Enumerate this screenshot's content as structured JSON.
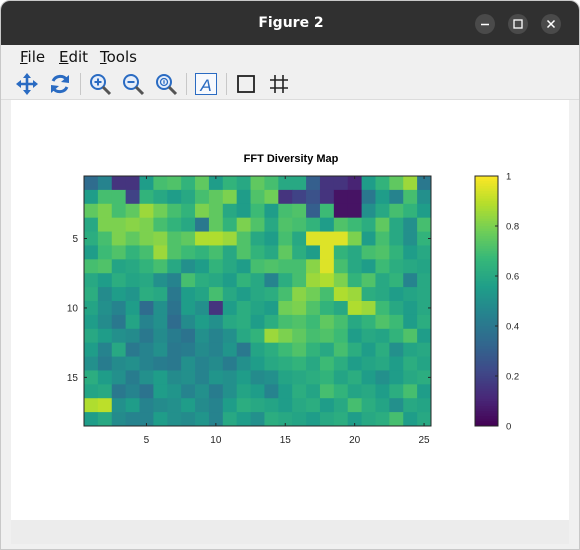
{
  "window": {
    "title": "Figure 2",
    "min_icon": "minimize-icon",
    "max_icon": "maximize-icon",
    "close_icon": "close-icon"
  },
  "menu": {
    "items": [
      {
        "label": "File",
        "key": "F",
        "rest": "ile"
      },
      {
        "label": "Edit",
        "key": "E",
        "rest": "dit"
      },
      {
        "label": "Tools",
        "key": "T",
        "rest": "ools"
      }
    ]
  },
  "toolbar": {
    "tools": [
      "pan-icon",
      "rotate-icon",
      "zoom-in-icon",
      "zoom-out-icon",
      "zoom-reset-icon",
      "text-insert-icon",
      "axes-box-icon",
      "grid-icon"
    ]
  },
  "colors": {
    "title_bar": "#303030",
    "accent": "#2266cc",
    "colormap": "viridis"
  },
  "chart_data": {
    "type": "heatmap",
    "title": "FFT Diversity Map",
    "x_ticks": [
      5,
      10,
      15,
      20,
      25
    ],
    "y_ticks": [
      5,
      10,
      15
    ],
    "xlim": [
      0.5,
      25.5
    ],
    "ylim": [
      0.5,
      18.5
    ],
    "colorbar_ticks": [
      "0",
      "0.2",
      "0.4",
      "0.6",
      "0.8",
      "1"
    ],
    "colorbar_range": [
      0,
      1
    ],
    "colormap": "viridis",
    "rows": 18,
    "cols": 25,
    "values": [
      [
        0.35,
        0.45,
        0.15,
        0.15,
        0.55,
        0.7,
        0.72,
        0.65,
        0.75,
        0.55,
        0.65,
        0.6,
        0.75,
        0.7,
        0.6,
        0.6,
        0.3,
        0.15,
        0.15,
        0.1,
        0.55,
        0.65,
        0.75,
        0.85,
        0.4
      ],
      [
        0.55,
        0.7,
        0.7,
        0.2,
        0.65,
        0.6,
        0.55,
        0.6,
        0.7,
        0.75,
        0.8,
        0.55,
        0.72,
        0.78,
        0.15,
        0.2,
        0.25,
        0.15,
        0.05,
        0.05,
        0.4,
        0.55,
        0.45,
        0.7,
        0.5
      ],
      [
        0.75,
        0.8,
        0.7,
        0.75,
        0.85,
        0.78,
        0.7,
        0.65,
        0.8,
        0.75,
        0.6,
        0.55,
        0.68,
        0.55,
        0.7,
        0.72,
        0.3,
        0.68,
        0.05,
        0.05,
        0.5,
        0.6,
        0.7,
        0.65,
        0.55
      ],
      [
        0.6,
        0.8,
        0.8,
        0.82,
        0.8,
        0.7,
        0.65,
        0.6,
        0.4,
        0.75,
        0.65,
        0.8,
        0.72,
        0.6,
        0.72,
        0.7,
        0.65,
        0.55,
        0.72,
        0.68,
        0.62,
        0.75,
        0.6,
        0.5,
        0.7
      ],
      [
        0.62,
        0.7,
        0.8,
        0.75,
        0.8,
        0.82,
        0.72,
        0.75,
        0.88,
        0.88,
        0.85,
        0.72,
        0.6,
        0.55,
        0.7,
        0.6,
        0.95,
        0.95,
        0.95,
        0.8,
        0.55,
        0.7,
        0.6,
        0.5,
        0.65
      ],
      [
        0.55,
        0.68,
        0.72,
        0.65,
        0.7,
        0.85,
        0.72,
        0.68,
        0.65,
        0.7,
        0.6,
        0.72,
        0.65,
        0.6,
        0.75,
        0.62,
        0.55,
        0.95,
        0.65,
        0.6,
        0.7,
        0.72,
        0.65,
        0.55,
        0.6
      ],
      [
        0.7,
        0.72,
        0.58,
        0.6,
        0.65,
        0.7,
        0.6,
        0.5,
        0.55,
        0.65,
        0.6,
        0.55,
        0.7,
        0.72,
        0.7,
        0.7,
        0.82,
        0.95,
        0.7,
        0.6,
        0.55,
        0.68,
        0.62,
        0.6,
        0.58
      ],
      [
        0.6,
        0.55,
        0.62,
        0.58,
        0.6,
        0.5,
        0.45,
        0.7,
        0.62,
        0.6,
        0.55,
        0.65,
        0.6,
        0.45,
        0.62,
        0.7,
        0.85,
        0.88,
        0.8,
        0.65,
        0.72,
        0.6,
        0.65,
        0.45,
        0.6
      ],
      [
        0.62,
        0.48,
        0.55,
        0.52,
        0.62,
        0.6,
        0.4,
        0.55,
        0.58,
        0.7,
        0.6,
        0.55,
        0.6,
        0.62,
        0.7,
        0.82,
        0.78,
        0.7,
        0.88,
        0.85,
        0.62,
        0.6,
        0.55,
        0.58,
        0.6
      ],
      [
        0.58,
        0.5,
        0.45,
        0.55,
        0.35,
        0.5,
        0.38,
        0.55,
        0.5,
        0.15,
        0.55,
        0.62,
        0.58,
        0.55,
        0.78,
        0.8,
        0.72,
        0.65,
        0.6,
        0.88,
        0.85,
        0.68,
        0.6,
        0.55,
        0.6
      ],
      [
        0.55,
        0.48,
        0.4,
        0.58,
        0.45,
        0.5,
        0.35,
        0.48,
        0.55,
        0.5,
        0.6,
        0.62,
        0.55,
        0.62,
        0.7,
        0.72,
        0.68,
        0.75,
        0.7,
        0.6,
        0.65,
        0.72,
        0.68,
        0.55,
        0.62
      ],
      [
        0.6,
        0.55,
        0.5,
        0.48,
        0.4,
        0.48,
        0.42,
        0.38,
        0.5,
        0.45,
        0.5,
        0.6,
        0.65,
        0.85,
        0.8,
        0.75,
        0.7,
        0.72,
        0.68,
        0.55,
        0.6,
        0.58,
        0.65,
        0.72,
        0.55
      ],
      [
        0.55,
        0.45,
        0.6,
        0.4,
        0.45,
        0.5,
        0.4,
        0.42,
        0.48,
        0.45,
        0.52,
        0.4,
        0.58,
        0.62,
        0.68,
        0.72,
        0.65,
        0.6,
        0.7,
        0.62,
        0.55,
        0.62,
        0.5,
        0.58,
        0.6
      ],
      [
        0.5,
        0.42,
        0.48,
        0.5,
        0.45,
        0.42,
        0.4,
        0.5,
        0.45,
        0.48,
        0.42,
        0.5,
        0.55,
        0.6,
        0.62,
        0.65,
        0.6,
        0.68,
        0.62,
        0.55,
        0.58,
        0.6,
        0.55,
        0.62,
        0.58
      ],
      [
        0.62,
        0.55,
        0.5,
        0.42,
        0.5,
        0.55,
        0.48,
        0.5,
        0.45,
        0.52,
        0.5,
        0.55,
        0.48,
        0.5,
        0.58,
        0.6,
        0.62,
        0.65,
        0.58,
        0.62,
        0.55,
        0.5,
        0.55,
        0.6,
        0.62
      ],
      [
        0.58,
        0.6,
        0.4,
        0.45,
        0.38,
        0.55,
        0.52,
        0.45,
        0.5,
        0.42,
        0.5,
        0.58,
        0.55,
        0.45,
        0.55,
        0.62,
        0.58,
        0.7,
        0.65,
        0.58,
        0.6,
        0.55,
        0.62,
        0.7,
        0.55
      ],
      [
        0.88,
        0.9,
        0.5,
        0.55,
        0.45,
        0.48,
        0.5,
        0.55,
        0.48,
        0.45,
        0.55,
        0.62,
        0.6,
        0.58,
        0.55,
        0.6,
        0.62,
        0.55,
        0.6,
        0.7,
        0.62,
        0.58,
        0.5,
        0.6,
        0.58
      ],
      [
        0.55,
        0.6,
        0.48,
        0.45,
        0.45,
        0.55,
        0.5,
        0.48,
        0.52,
        0.45,
        0.6,
        0.55,
        0.5,
        0.62,
        0.6,
        0.58,
        0.55,
        0.6,
        0.62,
        0.55,
        0.6,
        0.62,
        0.7,
        0.55,
        0.6
      ]
    ]
  }
}
